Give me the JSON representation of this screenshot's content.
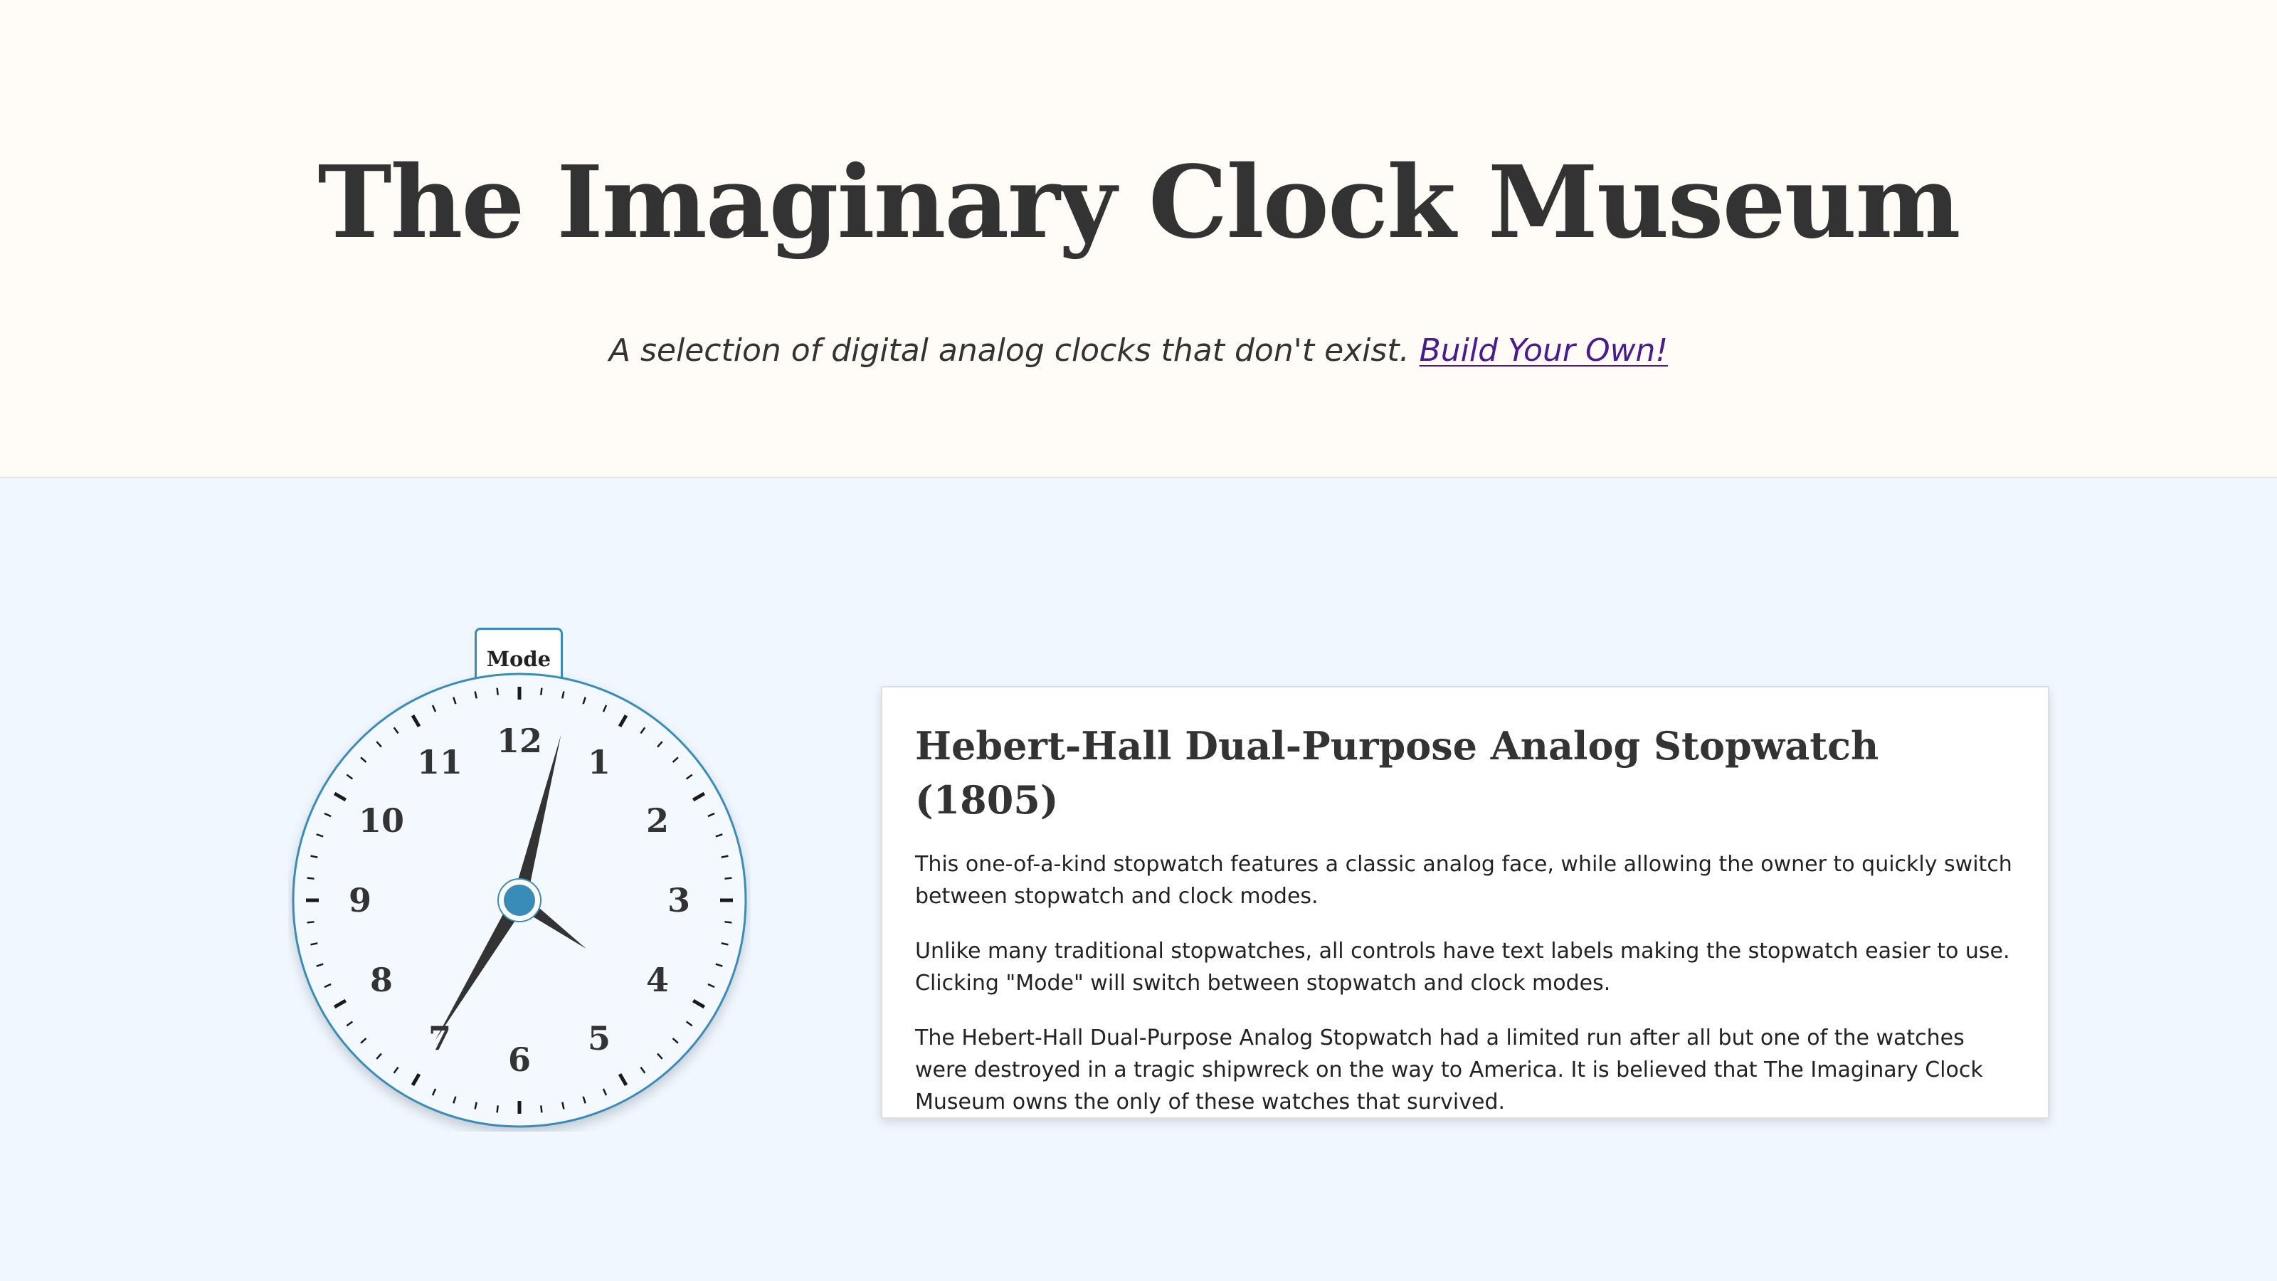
{
  "header": {
    "title": "The Imaginary Clock Museum",
    "subtitle": "A selection of digital analog clocks that don't exist.",
    "build_link": "Build Your Own!"
  },
  "clock": {
    "mode_label": "Mode",
    "numerals": [
      "12",
      "1",
      "2",
      "3",
      "4",
      "5",
      "6",
      "7",
      "8",
      "9",
      "10",
      "11"
    ],
    "time": {
      "hour": 7,
      "minute": 2,
      "second": 21
    },
    "colors": {
      "accent": "#3a8cb8",
      "face": "#f4f9ff",
      "hands": "#333333"
    }
  },
  "card": {
    "title": "Hebert-Hall Dual-Purpose Analog Stopwatch (1805)",
    "paragraphs": [
      "This one-of-a-kind stopwatch features a classic analog face, while allowing the owner to quickly switch between stopwatch and clock modes.",
      "Unlike many traditional stopwatches, all controls have text labels making the stopwatch easier to use. Clicking \"Mode\" will switch between stopwatch and clock modes.",
      "The Hebert-Hall Dual-Purpose Analog Stopwatch had a limited run after all but one of the watches were destroyed in a tragic shipwreck on the way to America. It is believed that The Imaginary Clock Museum owns the only of these watches that survived."
    ]
  }
}
